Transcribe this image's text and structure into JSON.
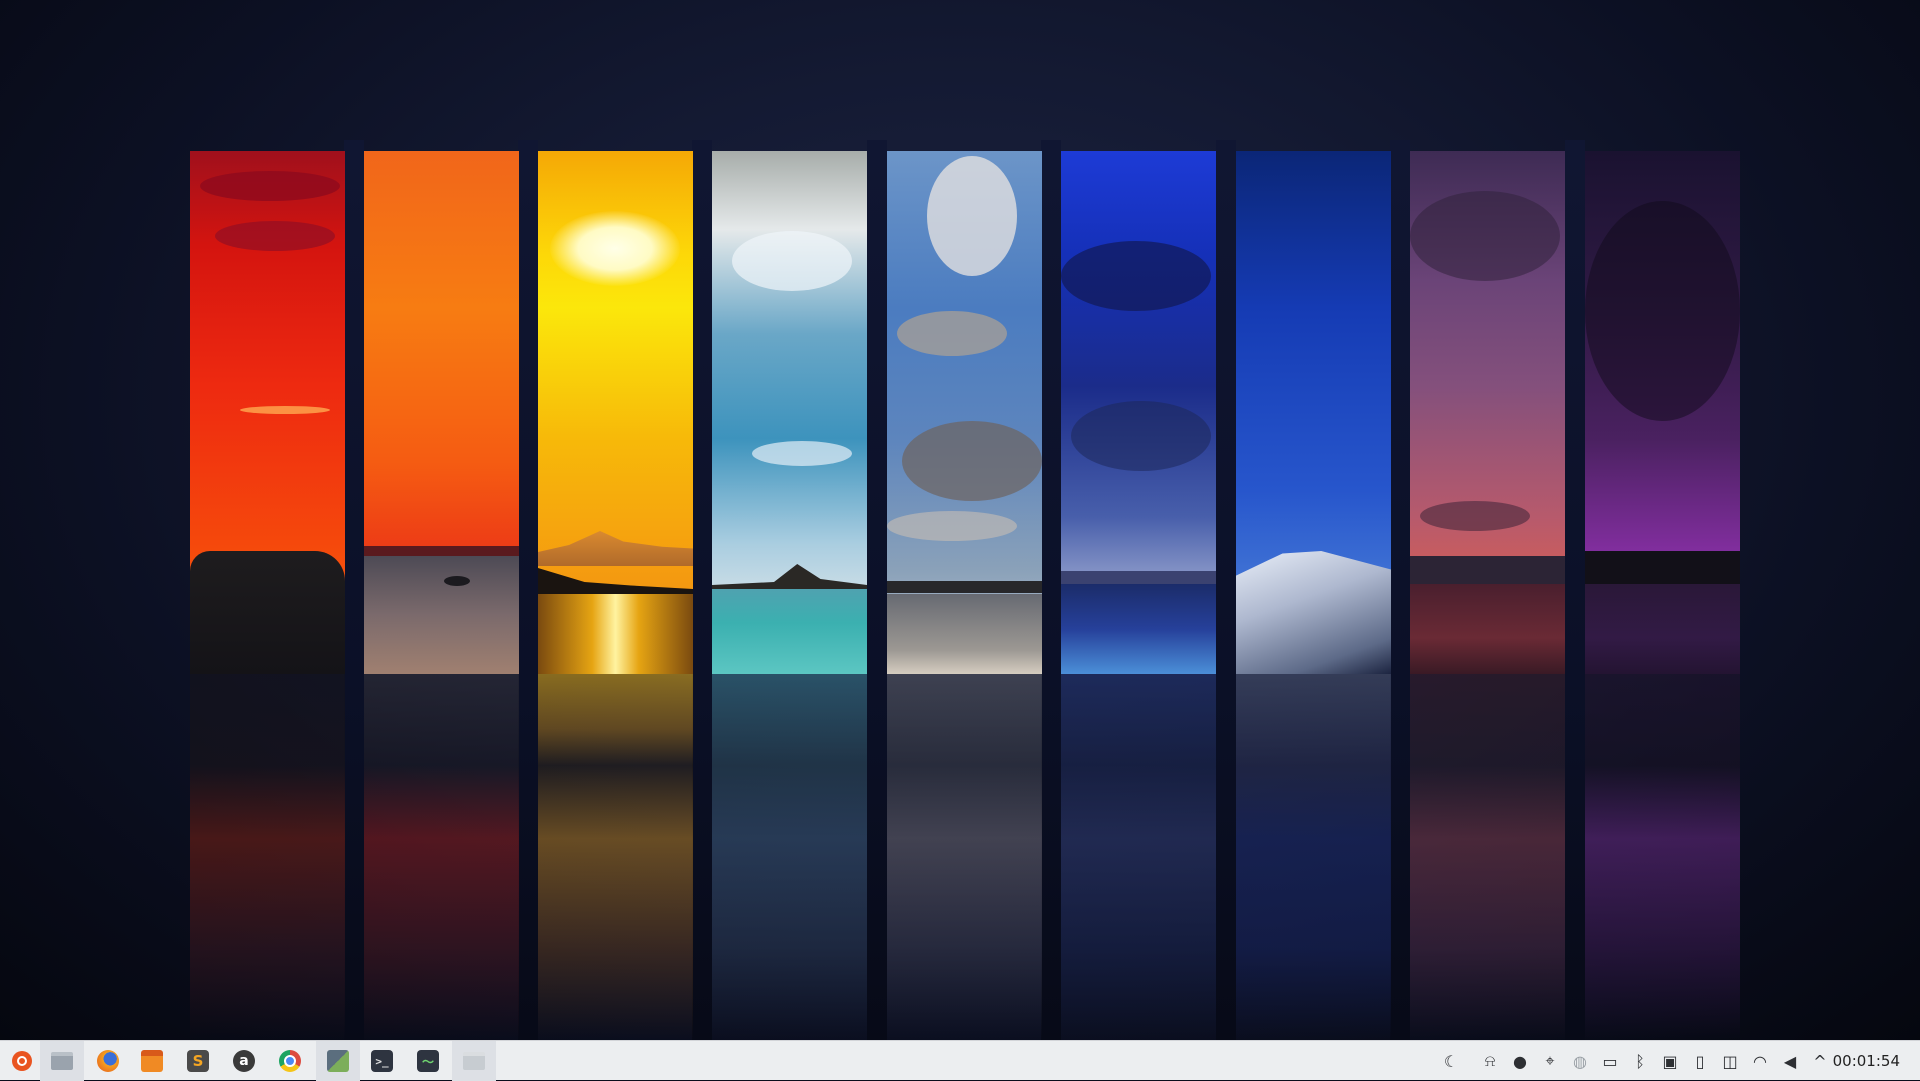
{
  "taskbar": {
    "apps": [
      {
        "id": "ubuntu-menu",
        "icon": "ubuntu-logo-icon",
        "color": "#e95420"
      },
      {
        "id": "files",
        "icon": "folder-icon",
        "color": "#9aa3ad"
      },
      {
        "id": "firefox",
        "icon": "firefox-icon",
        "color": "#f07a18"
      },
      {
        "id": "calendar",
        "icon": "calendar-icon",
        "color": "#f08a24"
      },
      {
        "id": "sublime-text",
        "icon": "sublime-text-icon",
        "color": "#4a4a4a"
      },
      {
        "id": "amazon",
        "icon": "amazon-icon",
        "color": "#3a3a3a"
      },
      {
        "id": "chrome",
        "icon": "chrome-icon",
        "color": "#dd4b3e"
      },
      {
        "id": "image-viewer",
        "icon": "image-viewer-icon",
        "color": "#5b6e7e"
      },
      {
        "id": "terminal",
        "icon": "terminal-icon",
        "color": "#2e3440"
      },
      {
        "id": "system-monitor",
        "icon": "system-monitor-icon",
        "color": "#2e3440"
      },
      {
        "id": "file-manager",
        "icon": "file-manager-icon",
        "color": "#aab0b6"
      }
    ],
    "amazon_glyph": "a",
    "tray_icons": [
      "night-mode-icon",
      "notification-bell-icon",
      "user-icon",
      "location-icon",
      "vpn-icon",
      "battery-icon",
      "bluetooth-icon",
      "display-icon",
      "usb-drive-icon",
      "storage-icon",
      "wifi-icon",
      "volume-icon",
      "chevron-up-icon"
    ],
    "clock": "00:01:54"
  },
  "wallpaper": {
    "name": "spectrum-horizons",
    "colors": [
      "#e3170a",
      "#f7700f",
      "#f9cf07",
      "#62a3c4",
      "#6f8fc0",
      "#1a35b8",
      "#1c45bf",
      "#a25574",
      "#5a2475"
    ]
  }
}
